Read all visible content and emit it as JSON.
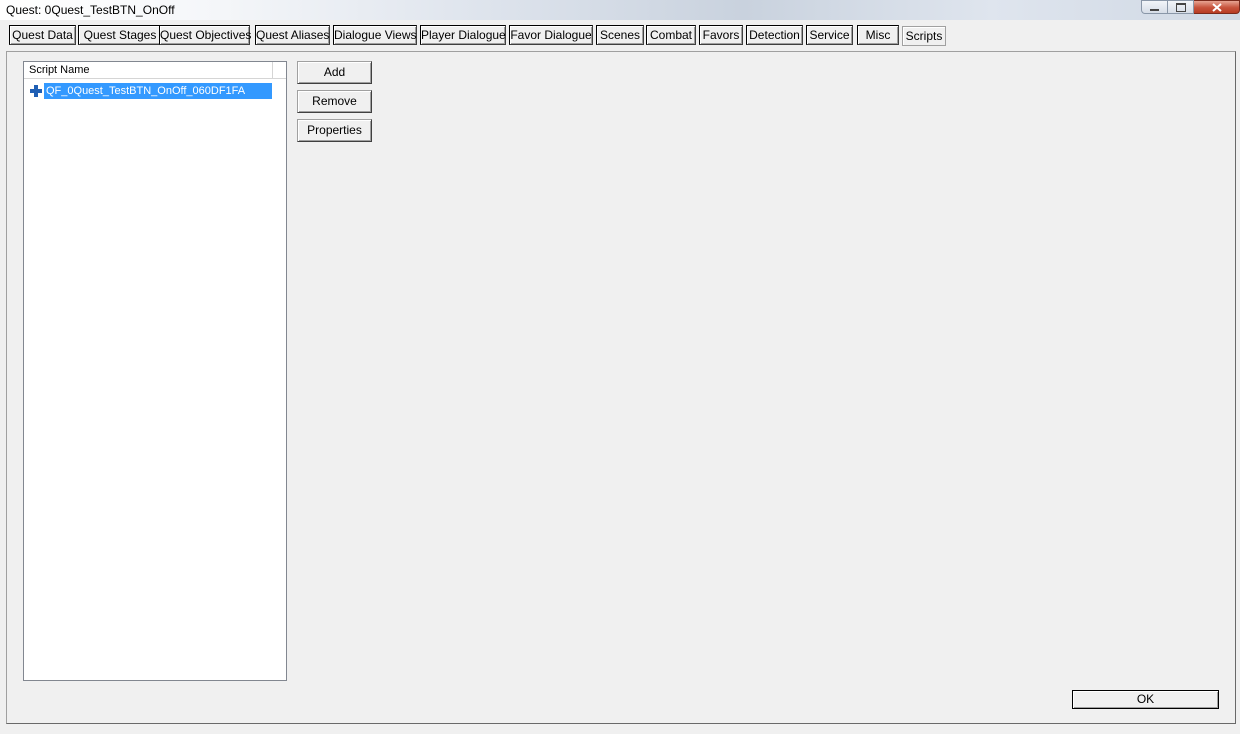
{
  "window": {
    "title": "Quest: 0Quest_TestBTN_OnOff"
  },
  "tabs": [
    {
      "label": "Quest Data"
    },
    {
      "label": "Quest Stages"
    },
    {
      "label": "Quest Objectives"
    },
    {
      "label": "Quest Aliases"
    },
    {
      "label": "Dialogue Views"
    },
    {
      "label": "Player Dialogue"
    },
    {
      "label": "Favor Dialogue"
    },
    {
      "label": "Scenes"
    },
    {
      "label": "Combat"
    },
    {
      "label": "Favors"
    },
    {
      "label": "Detection"
    },
    {
      "label": "Service"
    },
    {
      "label": "Misc"
    },
    {
      "label": "Scripts",
      "active": true
    }
  ],
  "scripts_panel": {
    "column_header": "Script Name",
    "rows": [
      {
        "name": "QF_0Quest_TestBTN_OnOff_060DF1FA",
        "icon": "plus-icon",
        "selected": true
      }
    ],
    "buttons": {
      "add": "Add",
      "remove": "Remove",
      "properties": "Properties"
    }
  },
  "footer": {
    "ok": "OK"
  },
  "colors": {
    "selection": "#3399ff",
    "plus_icon": "#1f5fb4",
    "background": "#f0f0f0"
  }
}
